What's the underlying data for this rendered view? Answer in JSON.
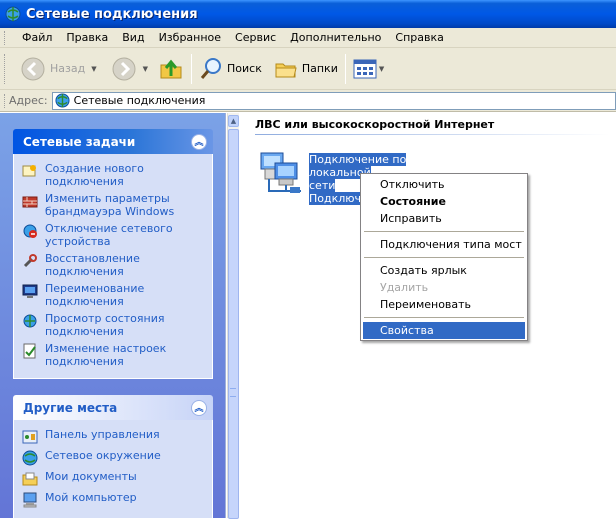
{
  "window": {
    "title": "Сетевые подключения"
  },
  "menu": [
    "Файл",
    "Правка",
    "Вид",
    "Избранное",
    "Сервис",
    "Дополнительно",
    "Справка"
  ],
  "toolbar": {
    "back_label": "Назад",
    "search_label": "Поиск",
    "folders_label": "Папки"
  },
  "address": {
    "label": "Адрес:",
    "value": "Сетевые подключения"
  },
  "network_tasks": {
    "title": "Сетевые задачи",
    "items": [
      {
        "line1": "Создание нового",
        "line2": "подключения",
        "icon": "new-connection-icon"
      },
      {
        "line1": "Изменить параметры",
        "line2": "брандмауэра Windows",
        "icon": "firewall-icon"
      },
      {
        "line1": "Отключение сетевого",
        "line2": "устройства",
        "icon": "disable-device-icon"
      },
      {
        "line1": "Восстановление",
        "line2": "подключения",
        "icon": "repair-icon"
      },
      {
        "line1": "Переименование",
        "line2": "подключения",
        "icon": "rename-icon"
      },
      {
        "line1": "Просмотр состояния",
        "line2": "подключения",
        "icon": "status-icon"
      },
      {
        "line1": "Изменение настроек",
        "line2": "подключения",
        "icon": "settings-icon"
      }
    ]
  },
  "other_places": {
    "title": "Другие места",
    "items": [
      {
        "label": "Панель управления",
        "icon": "control-panel-icon"
      },
      {
        "label": "Сетевое окружение",
        "icon": "network-places-icon"
      },
      {
        "label": "Мои документы",
        "icon": "my-documents-icon"
      },
      {
        "label": "Мой компьютер",
        "icon": "my-computer-icon"
      }
    ]
  },
  "main": {
    "group_header": "ЛВС или высокоскоростной Интернет",
    "connection": {
      "line1": "Подключение по локальной",
      "line2": "сети",
      "line3": "Подключ"
    }
  },
  "context_menu": {
    "items": [
      "Отключить",
      "Состояние",
      "Исправить",
      "Подключения типа мост",
      "Создать ярлык",
      "Удалить",
      "Переименовать",
      "Свойства"
    ]
  },
  "colors": {
    "selection": "#316ac5",
    "link": "#215dc6",
    "titlebar": "#0058e6"
  }
}
